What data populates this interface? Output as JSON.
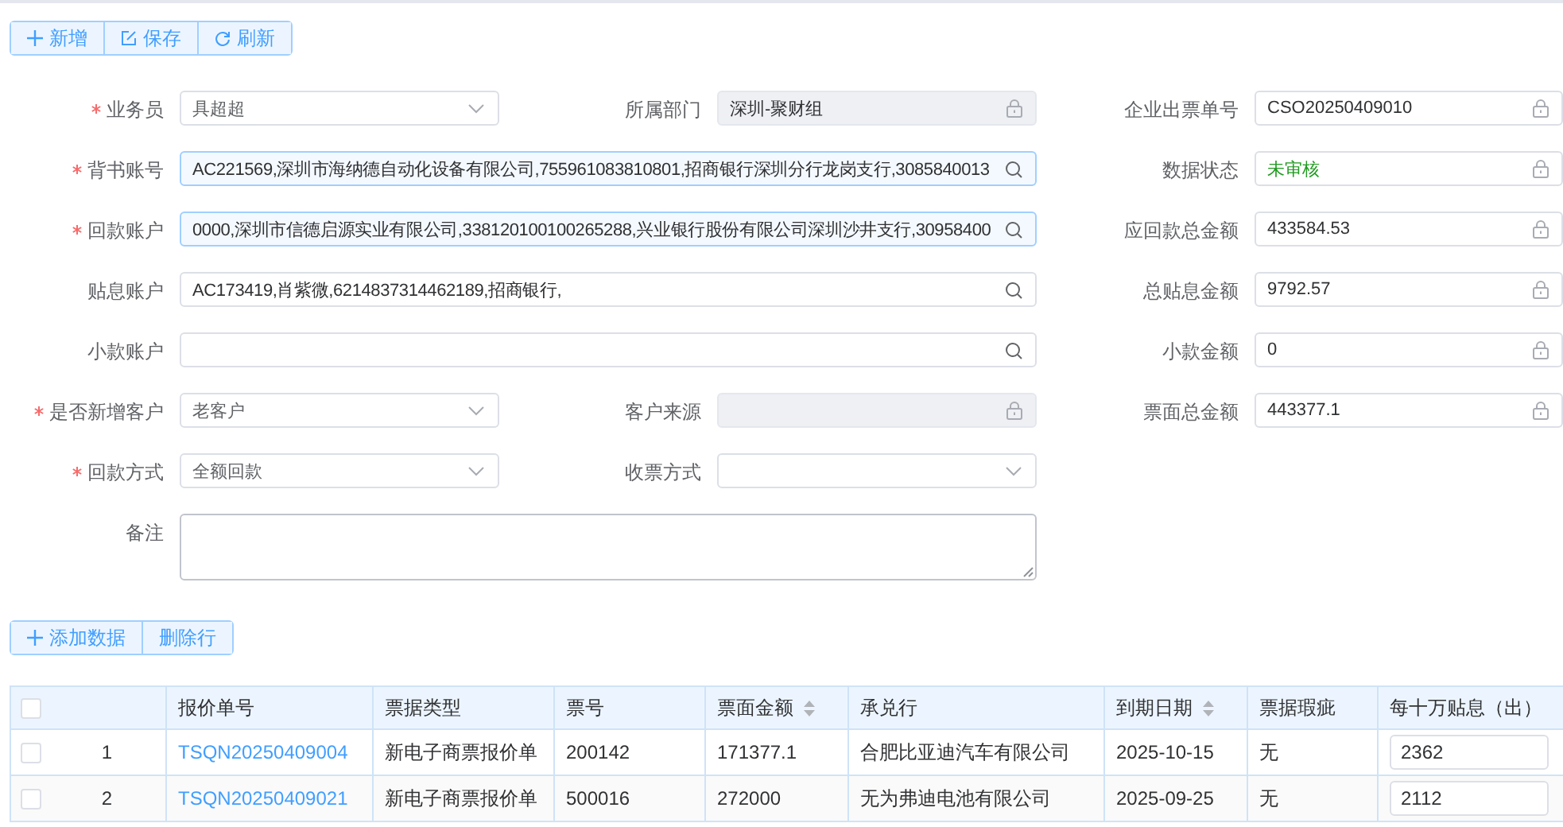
{
  "toolbar": [
    {
      "label": "新增"
    },
    {
      "label": "保存"
    },
    {
      "label": "刷新"
    }
  ],
  "form": {
    "rows": [
      [
        {
          "label": "业务员",
          "required": true,
          "kind": "select",
          "value": "具超超"
        },
        {
          "label": "所属部门",
          "required": false,
          "kind": "locked",
          "disabled": true,
          "value": "深圳-聚财组"
        },
        {
          "label": "企业出票单号",
          "required": false,
          "kind": "locked",
          "disabled": false,
          "value": "CSO20250409010"
        }
      ],
      [
        {
          "label": "背书账号",
          "required": true,
          "kind": "search",
          "wide": true,
          "highlighted": true,
          "value": "AC221569,深圳市海纳德自动化设备有限公司,755961083810801,招商银行深圳分行龙岗支行,3085840013"
        },
        {
          "label": "数据状态",
          "required": false,
          "kind": "locked",
          "disabled": false,
          "value": "未审核",
          "color": "#1f9a1f"
        }
      ],
      [
        {
          "label": "回款账户",
          "required": true,
          "kind": "search",
          "wide": true,
          "highlighted": true,
          "value": "0000,深圳市信德启源实业有限公司,338120100100265288,兴业银行股份有限公司深圳沙井支行,30958400"
        },
        {
          "label": "应回款总金额",
          "required": false,
          "kind": "locked",
          "disabled": false,
          "value": "433584.53"
        }
      ],
      [
        {
          "label": "贴息账户",
          "required": false,
          "kind": "search",
          "wide": true,
          "highlighted": false,
          "value": "AC173419,肖紫微,6214837314462189,招商银行,"
        },
        {
          "label": "总贴息金额",
          "required": false,
          "kind": "locked",
          "disabled": false,
          "value": "9792.57"
        }
      ],
      [
        {
          "label": "小款账户",
          "required": false,
          "kind": "search",
          "wide": true,
          "highlighted": false
        },
        {
          "label": "小款金额",
          "required": false,
          "kind": "locked",
          "disabled": false,
          "value": "0"
        }
      ],
      [
        {
          "label": "是否新增客户",
          "required": true,
          "kind": "select",
          "value": "老客户"
        },
        {
          "label": "客户来源",
          "required": false,
          "kind": "locked",
          "disabled": true
        },
        {
          "label": "票面总金额",
          "required": false,
          "kind": "locked",
          "disabled": false,
          "value": "443377.1"
        }
      ],
      [
        {
          "label": "回款方式",
          "required": true,
          "kind": "select",
          "value": "全额回款"
        },
        {
          "label": "收票方式",
          "required": false,
          "kind": "select"
        }
      ],
      [
        {
          "label": "备注",
          "required": false,
          "kind": "textarea",
          "wide": true
        }
      ]
    ]
  },
  "table_toolbar": [
    {
      "label": "添加数据"
    },
    {
      "label": "删除行"
    }
  ],
  "table": {
    "select_all": {
      "checked": false
    },
    "columns": [
      {
        "label": "报价单号"
      },
      {
        "label": "票据类型"
      },
      {
        "label": "票号"
      },
      {
        "label": "票面金额",
        "sortable": true
      },
      {
        "label": "承兑行"
      },
      {
        "label": "到期日期",
        "sortable": true
      },
      {
        "label": "票据瑕疵"
      },
      {
        "label": "每十万贴息（出）"
      }
    ],
    "rows": [
      {
        "checked": false,
        "index": "1",
        "quote_no": "TSQN20250409004",
        "bill_type": "新电子商票报价单",
        "bill_no": "200142",
        "amount": "171377.1",
        "acceptor": "合肥比亚迪汽车有限公司",
        "due_date": "2025-10-15",
        "flaw": "无",
        "rate": "2362"
      },
      {
        "checked": false,
        "index": "2",
        "quote_no": "TSQN20250409021",
        "bill_type": "新电子商票报价单",
        "bill_no": "500016",
        "amount": "272000",
        "acceptor": "无为弗迪电池有限公司",
        "due_date": "2025-09-25",
        "flaw": "无",
        "rate": "2112"
      }
    ]
  }
}
